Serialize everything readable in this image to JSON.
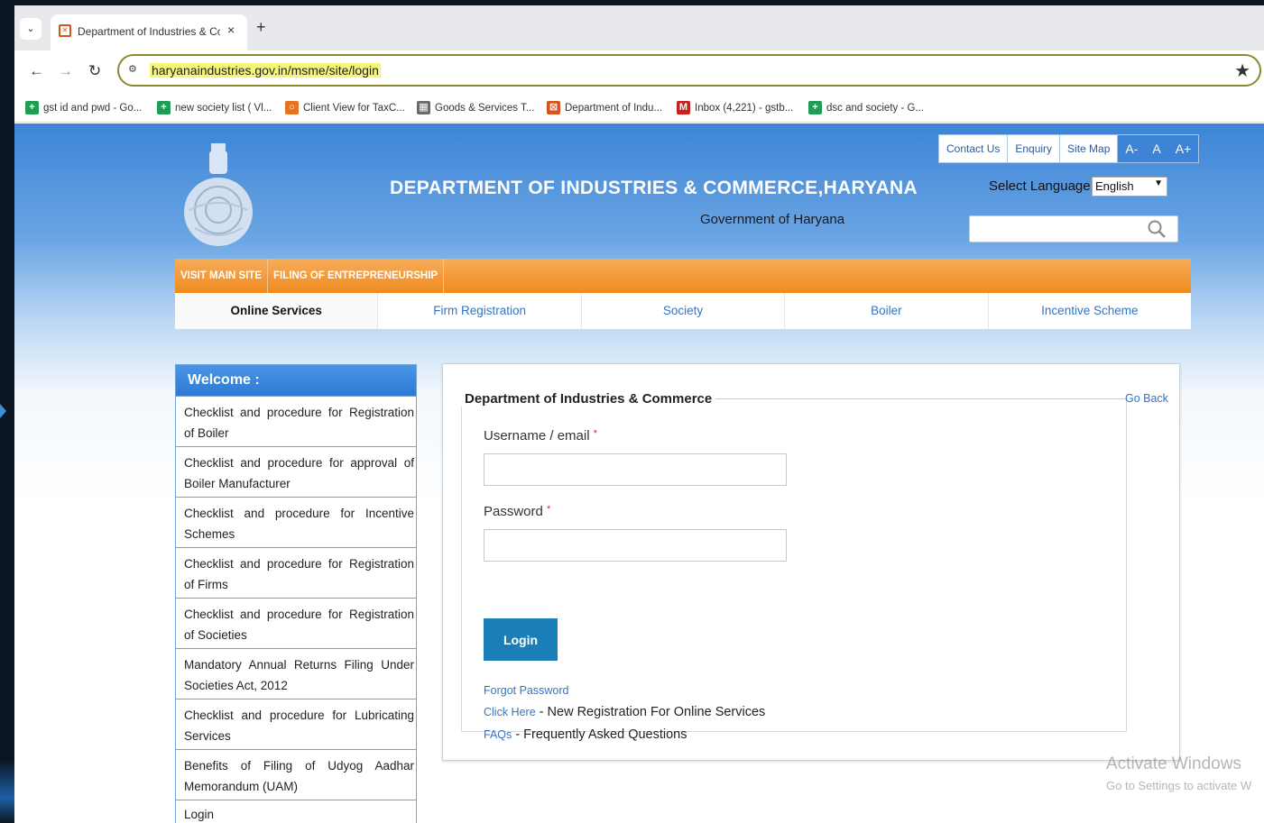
{
  "browser": {
    "tab_title": "Department of Industries & Co",
    "tab_close": "×",
    "new_tab": "+",
    "url": "haryanaindustries.gov.in/msme/site/login",
    "bookmarks": [
      {
        "label": "gst id and pwd - Go...",
        "color": "#1f9d55",
        "icon": "+"
      },
      {
        "label": "new society list ( Vl...",
        "color": "#1f9d55",
        "icon": "+"
      },
      {
        "label": "Client View for TaxC...",
        "color": "#e8731e",
        "icon": "○"
      },
      {
        "label": "Goods & Services T...",
        "color": "#6b6b6b",
        "icon": "▦"
      },
      {
        "label": "Department of Indu...",
        "color": "#d9531e",
        "icon": "⊠"
      },
      {
        "label": "Inbox (4,221) - gstb...",
        "color": "#c5221f",
        "icon": "M"
      },
      {
        "label": "dsc and society - G...",
        "color": "#1f9d55",
        "icon": "+"
      }
    ]
  },
  "header": {
    "title": "DEPARTMENT OF INDUSTRIES & COMMERCE,HARYANA",
    "subtitle": "Government of Haryana",
    "top_links": [
      "Contact Us",
      "Enquiry",
      "Site Map"
    ],
    "font_sizes": [
      "A-",
      "A",
      "A+"
    ],
    "language_label": "Select Language",
    "language_value": "English"
  },
  "orange_nav": [
    "VISIT MAIN SITE",
    "FILING OF ENTREPRENEURSHIP"
  ],
  "services": [
    "Online Services",
    "Firm Registration",
    "Society",
    "Boiler",
    "Incentive Scheme"
  ],
  "sidebar": {
    "heading": "Welcome :",
    "items": [
      "Checklist and procedure for Registration of Boiler",
      "Checklist and procedure for approval of Boiler Manufacturer",
      "Checklist and procedure for Incentive Schemes",
      "Checklist and procedure for Registration of Firms",
      "Checklist and procedure for Registration of Societies",
      "Mandatory Annual Returns Filing Under Societies Act, 2012",
      "Checklist and procedure for Lubricating Services",
      "Benefits of Filing of Udyog Aadhar Memorandum (UAM)",
      "Login"
    ]
  },
  "login": {
    "legend": "Department of Industries & Commerce",
    "go_back": "Go Back",
    "username_label": "Username / email",
    "password_label": "Password",
    "required_mark": "*",
    "login_button": "Login",
    "forgot_password": "Forgot Password",
    "click_here": "Click Here",
    "click_here_rest": " - New Registration For Online Services",
    "faqs": "FAQs",
    "faqs_rest": " - Frequently Asked Questions"
  },
  "watermark": {
    "line1": "Activate Windows",
    "line2": "Go to Settings to activate W"
  }
}
